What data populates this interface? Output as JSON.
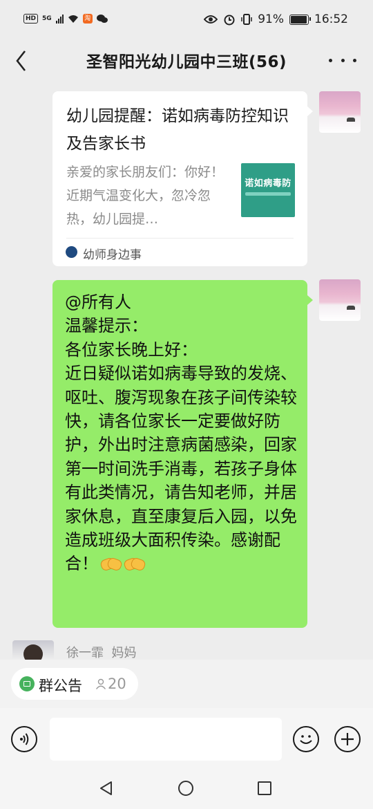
{
  "status_bar": {
    "hd_label": "HD",
    "net_label": "5G",
    "battery_percent": "91%",
    "time": "16:52"
  },
  "header": {
    "title": "圣智阳光幼儿园中三班(56)"
  },
  "messages": {
    "link_card": {
      "title": "幼儿园提醒：诺如病毒防控知识及告家长书",
      "description": "亲爱的家长朋友们：你好！近期气温变化大，忽冷忽热，幼儿园提…",
      "thumbnail_text": "诺如病毒防",
      "source": "幼师身边事"
    },
    "text_message": {
      "text": "@所有人\n温馨提示：\n各位家长晚上好：\n近日疑似诺如病毒导致的发烧、呕吐、腹泻现象在孩子间传染较快，请各位家长一定要做好防护，外出时注意病菌感染，回家第一时间洗手消毒，若孩子身体有此类情况，请告知老师，并居家休息，直至康复后入园，以免造成班级大面积传染。感谢配合！",
      "emoji": "handshake"
    },
    "next_sender": "徐一霏  妈妈"
  },
  "notice_bar": {
    "label": "群公告",
    "count": "20"
  },
  "input_bar": {
    "placeholder": ""
  },
  "colors": {
    "background": "#ededed",
    "bubble_green": "#95ec69",
    "notice_green": "#46b25d",
    "card_white": "#ffffff"
  },
  "icons": {
    "back": "chevron-left-icon",
    "more": "more-dots-icon",
    "voice": "voice-icon",
    "emoji": "emoji-icon",
    "plus": "plus-icon",
    "notice": "notice-icon",
    "member": "person-icon"
  }
}
